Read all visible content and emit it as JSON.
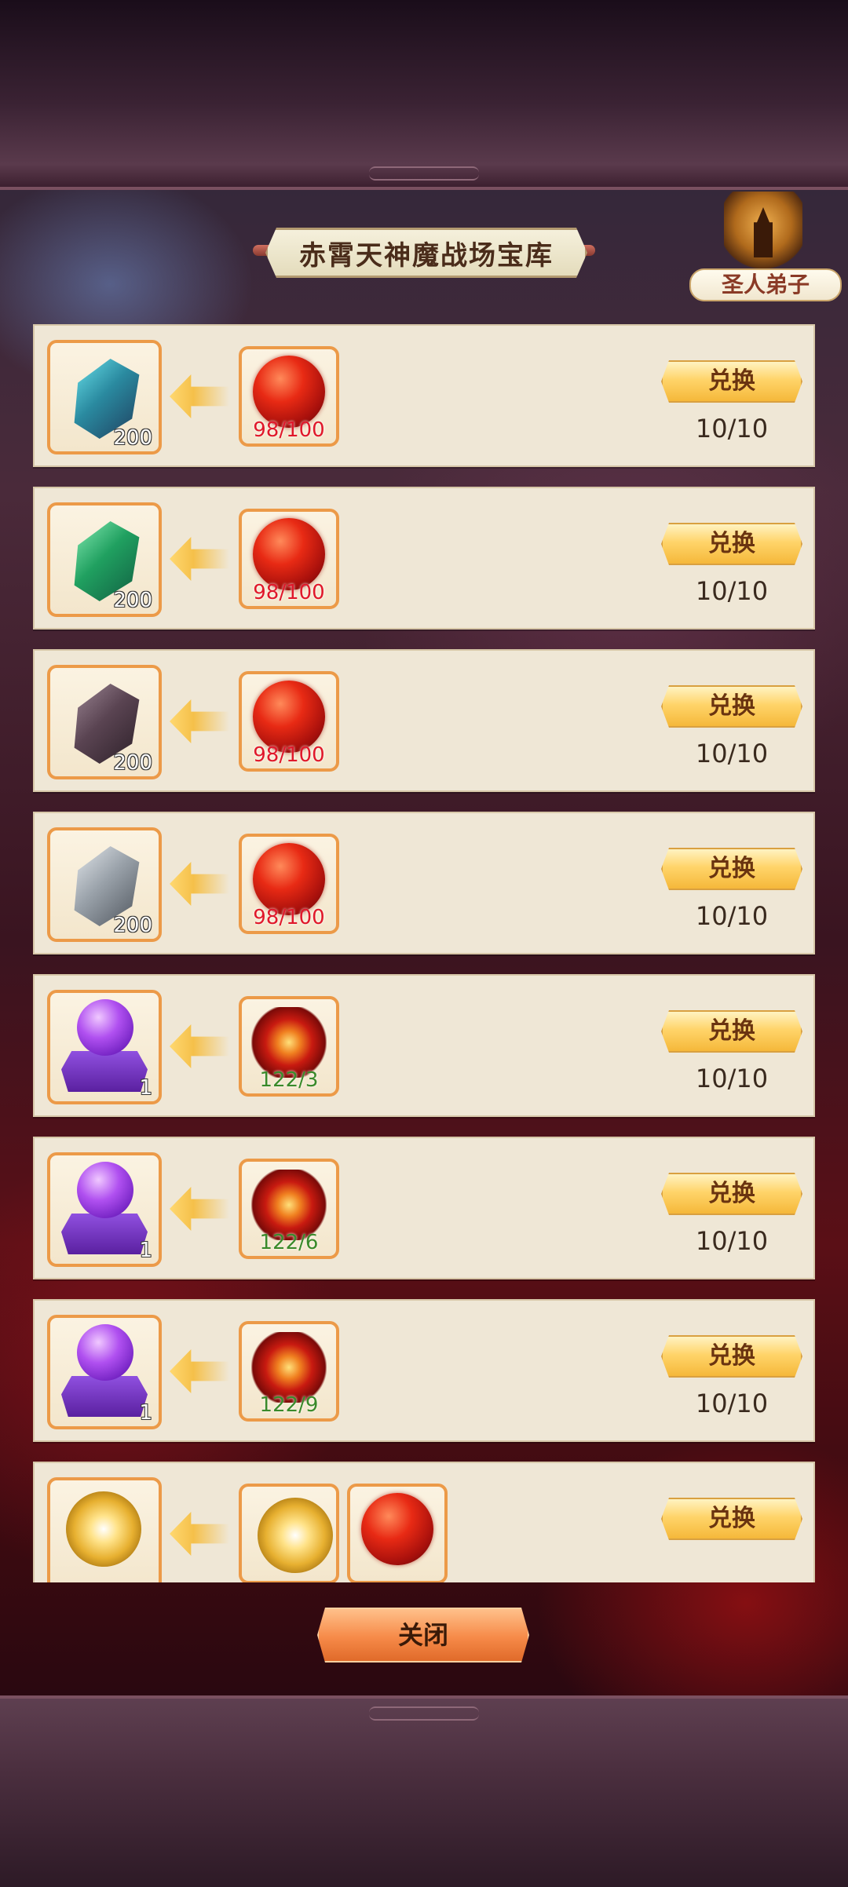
{
  "header": {
    "title": "赤霄天神魔战场宝库",
    "badge_label": "圣人弟子"
  },
  "rows": [
    {
      "reward": {
        "icon": "grey-stone-icon",
        "count": "200"
      },
      "costs": [
        {
          "icon": "red-orb-icon",
          "amount": "98/100",
          "style": "red"
        }
      ],
      "button_label": "兑换",
      "limit": "10/10"
    },
    {
      "reward": {
        "icon": "cyan-crystal-icon",
        "count": "200"
      },
      "costs": [
        {
          "icon": "red-orb-icon",
          "amount": "98/100",
          "style": "red"
        }
      ],
      "button_label": "兑换",
      "limit": "10/10"
    },
    {
      "reward": {
        "icon": "green-crystal-icon",
        "count": "200"
      },
      "costs": [
        {
          "icon": "red-orb-icon",
          "amount": "98/100",
          "style": "red"
        }
      ],
      "button_label": "兑换",
      "limit": "10/10"
    },
    {
      "reward": {
        "icon": "dark-crystal-icon",
        "count": "200"
      },
      "costs": [
        {
          "icon": "red-orb-icon",
          "amount": "98/100",
          "style": "red"
        }
      ],
      "button_label": "兑换",
      "limit": "10/10"
    },
    {
      "reward": {
        "icon": "grey-crystal-icon",
        "count": "200"
      },
      "costs": [
        {
          "icon": "red-orb-icon",
          "amount": "98/100",
          "style": "red"
        }
      ],
      "button_label": "兑换",
      "limit": "10/10"
    },
    {
      "reward": {
        "icon": "purple-crystal-ball-icon",
        "count": "1"
      },
      "costs": [
        {
          "icon": "fire-seal-icon",
          "amount": "122/3",
          "style": "green"
        }
      ],
      "button_label": "兑换",
      "limit": "10/10"
    },
    {
      "reward": {
        "icon": "purple-crystal-ball-icon",
        "count": "1"
      },
      "costs": [
        {
          "icon": "fire-seal-icon",
          "amount": "122/6",
          "style": "green"
        }
      ],
      "button_label": "兑换",
      "limit": "10/10"
    },
    {
      "reward": {
        "icon": "purple-crystal-ball-icon",
        "count": "1"
      },
      "costs": [
        {
          "icon": "fire-seal-icon",
          "amount": "122/9",
          "style": "green"
        }
      ],
      "button_label": "兑换",
      "limit": "10/10"
    },
    {
      "reward": {
        "icon": "gold-flower-icon",
        "count": ""
      },
      "costs": [
        {
          "icon": "gold-flower-icon",
          "amount": "",
          "style": "red"
        },
        {
          "icon": "red-orb-icon",
          "amount": "",
          "style": "red"
        }
      ],
      "button_label": "兑换",
      "limit": ""
    }
  ],
  "footer": {
    "close_label": "关闭"
  },
  "colors": {
    "accent_orange": "#ec9a48",
    "button_gold": "#ffd46a",
    "cost_red": "#e0182a",
    "cost_green": "#3a8a2a",
    "row_bg": "#efe7d6"
  }
}
